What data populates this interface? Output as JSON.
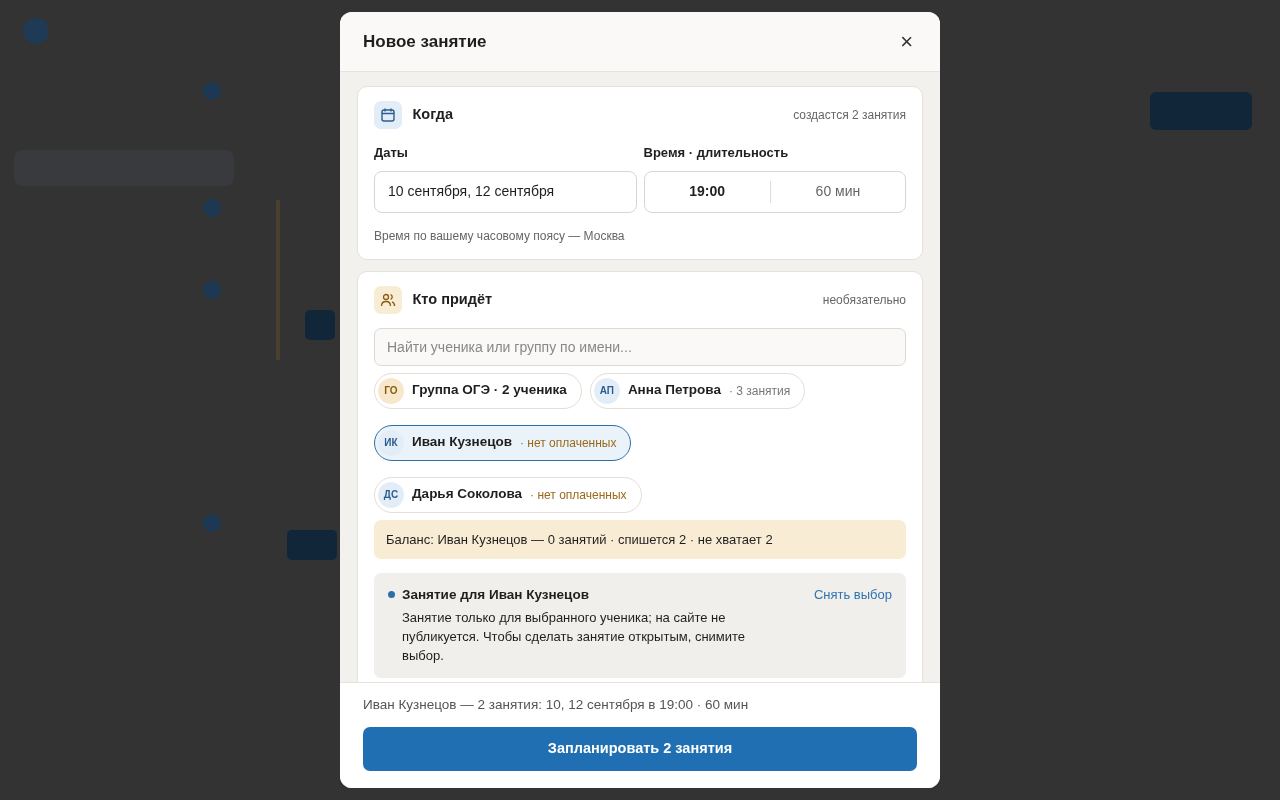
{
  "modal": {
    "title": "Новое занятие",
    "close": "×"
  },
  "when": {
    "title": "Когда",
    "hint": "создастся 2 занятия",
    "dates_label": "Даты",
    "dates_value": "10 сентября, 12 сентября",
    "time_label": "Время · длительность",
    "time_value": "19:00",
    "duration_value": "60 мин",
    "note": "Время по вашему часовому поясу — Москва"
  },
  "who": {
    "title": "Кто придёт",
    "hint": "необязательно",
    "search": {
      "placeholder": "Найти ученика или группу по имени..."
    },
    "chips": [
      {
        "kind": "group",
        "initials": "ГО",
        "name": "Группа ОГЭ · 2 ученика",
        "selected": false
      },
      {
        "kind": "student",
        "initials": "АП",
        "name": "Анна Петрова",
        "note": "· 3 занятия",
        "warning": false,
        "selected": false
      },
      {
        "kind": "student",
        "initials": "ИК",
        "name": "Иван Кузнецов",
        "note": "· нет оплаченных",
        "warning": true,
        "selected": true
      },
      {
        "kind": "student",
        "initials": "ДС",
        "name": "Дарья Соколова",
        "note": "· нет оплаченных",
        "warning": true,
        "selected": false
      }
    ],
    "balance": "Баланс: Иван Кузнецов — 0 занятий · спишется 2 · не хватает 2",
    "selection": {
      "title": "Занятие для Иван Кузнецов",
      "text": "Занятие только для выбранного ученика; на сайте не публикуется. Чтобы сделать занятие открытым, снимите выбор.",
      "clear": "Снять выбор"
    }
  },
  "footer": {
    "summary": "Иван Кузнецов — 2 занятия: 10, 12 сентября в 19:00 · 60 мин",
    "submit": "Запланировать 2 занятия"
  }
}
